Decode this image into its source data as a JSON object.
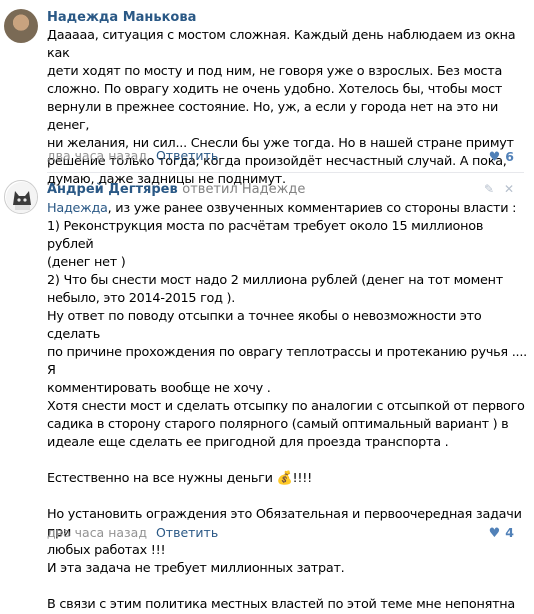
{
  "comments": [
    {
      "author": "Надежда Манькова",
      "text": "Дааааа, ситуация с мостом сложная. Каждый день наблюдаем из окна как\nдети ходят по мосту и под ним, не говоря уже о взрослых. Без моста\nсложно. По оврагу ходить не очень удобно. Хотелось бы, чтобы мост\nвернули в прежнее состояние. Но, уж, а если у города нет на это ни денег,\nни желания, ни сил... Снесли бы уже тогда. Но в нашей стране примут\nрешение только тогда, когда произойдёт несчастный случай. А пока,\nдумаю, даже задницы не поднимут.",
      "time": "два часа назад",
      "reply_label": "Ответить",
      "likes": "6"
    },
    {
      "author": "Андрей Дегтярев",
      "replied_text": "ответил Надежде",
      "mention": "Надежда",
      "text_after_mention": ", из уже ранее озвученных комментариев со стороны власти :\n1) Реконструкция моста по расчётам требует около 15 миллионов рублей\n(денег нет )\n2) Что бы снести мост надо 2 миллиона рублей (денег на тот момент\nнебыло, это 2014-2015 год ).\nНу ответ по поводу отсыпки а точнее якобы о невозможности это сделать\nпо причине прохождения по оврагу теплотрассы и протеканию ручья .... Я\nкомментировать вообще не хочу .\nХотя снести мост и сделать отсыпку по аналогии с отсыпкой от первого\nсадика в сторону старого полярного (самый оптимальный вариант ) в\nидеале еще сделать ее пригодной для проезда транспорта .\n\nЕстественно на все нужны деньги ",
      "emoji": "💰",
      "text_after_emoji": "!!!!\n\nНо установить ограждения это Обязательная и первоочередная задачи при\nлюбых работах !!!\nИ эта задача не требует миллионных затрат.\n\nВ связи с этим политика местных властей по этой теме мне непонятна",
      "time": "два часа назад",
      "reply_label": "Ответить",
      "likes": "4"
    }
  ],
  "icons": {
    "like": "heart-icon",
    "edit": "pencil-icon",
    "close": "close-icon"
  },
  "colors": {
    "link": "#2a5885",
    "muted": "#939393",
    "like": "#5181b8"
  }
}
